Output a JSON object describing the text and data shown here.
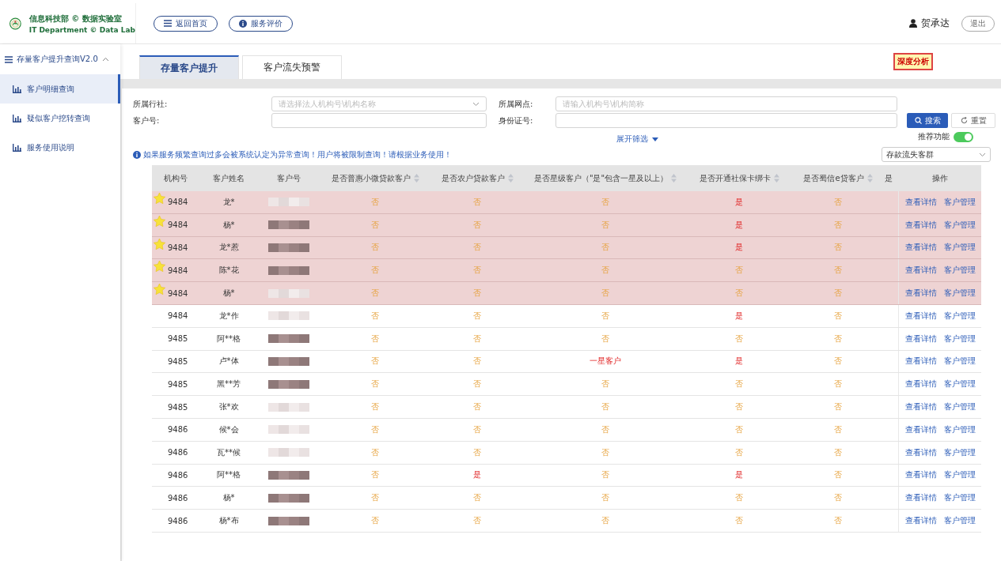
{
  "header": {
    "org_title": "信息科技部 © 数据实验室",
    "org_subtitle": "IT Department © Data Lab",
    "nav_buttons": [
      "返回首页",
      "服务评价"
    ],
    "user": "贺承达",
    "logout": "退出"
  },
  "sidebar": {
    "title": "存量客户提升查询V2.0",
    "expanded": true,
    "items": [
      {
        "label": "客户明细查询",
        "selected": true
      },
      {
        "label": "疑似客户挖转查询",
        "selected": false
      },
      {
        "label": "服务使用说明",
        "selected": false
      }
    ]
  },
  "tabs": [
    {
      "label": "存量客户提升",
      "selected": true
    },
    {
      "label": "客户流失预警",
      "selected": false
    }
  ],
  "badge": "深度分析",
  "form": {
    "fields": [
      {
        "label": "所属行社:",
        "placeholder": "请选择法人机构号\\机构名称",
        "kind": "select"
      },
      {
        "label": "所属网点:",
        "placeholder": "请输入机构号\\机构简称",
        "kind": "text"
      },
      {
        "label": "客户号:",
        "kind": "text"
      },
      {
        "label": "身份证号:",
        "kind": "text"
      }
    ],
    "search": "搜索",
    "reset": "重置",
    "expand": "展开筛选",
    "recommend": {
      "label": "推荐功能",
      "on": true
    },
    "group_select": "存款流失客群",
    "notice": "如果服务频繁查询过多会被系统认定为异常查询！用户将被限制查询！请根据业务使用！"
  },
  "table": {
    "columns": [
      {
        "label": "机构号",
        "sortable": false
      },
      {
        "label": "客户姓名",
        "sortable": false
      },
      {
        "label": "客户号",
        "sortable": false
      },
      {
        "label": "是否普惠小微贷款客户",
        "sortable": true
      },
      {
        "label": "是否农户贷款客户",
        "sortable": true
      },
      {
        "label": "是否星级客户（\"是\"包含一星及以上）",
        "sortable": true
      },
      {
        "label": "是否开通社保卡绑卡",
        "sortable": true
      },
      {
        "label": "是否蜀信e贷客户",
        "sortable": true
      },
      {
        "label": "是",
        "sortable": false
      },
      {
        "label": "操作",
        "sortable": false
      }
    ],
    "rows": [
      {
        "starred": true,
        "redacted": false,
        "cells": [
          "9484",
          "龙*",
          "",
          {
            "text": "否",
            "positive": false
          },
          {
            "text": "否",
            "positive": false
          },
          {
            "text": "否",
            "positive": false
          },
          {
            "text": "是",
            "positive": true
          },
          {
            "text": "否",
            "positive": false
          },
          ""
        ],
        "actions": [
          "查看详情",
          "客户管理"
        ]
      },
      {
        "starred": true,
        "redacted": true,
        "cells": [
          "9484",
          "杨*",
          "",
          {
            "text": "否",
            "positive": false
          },
          {
            "text": "否",
            "positive": false
          },
          {
            "text": "否",
            "positive": false
          },
          {
            "text": "是",
            "positive": true
          },
          {
            "text": "否",
            "positive": false
          },
          ""
        ],
        "actions": [
          "查看详情",
          "客户管理"
        ]
      },
      {
        "starred": true,
        "redacted": true,
        "cells": [
          "9484",
          "龙*惹",
          "",
          {
            "text": "否",
            "positive": false
          },
          {
            "text": "否",
            "positive": false
          },
          {
            "text": "否",
            "positive": false
          },
          {
            "text": "是",
            "positive": true
          },
          {
            "text": "否",
            "positive": false
          },
          ""
        ],
        "actions": [
          "查看详情",
          "客户管理"
        ]
      },
      {
        "starred": true,
        "redacted": true,
        "cells": [
          "9484",
          "陈*花",
          "",
          {
            "text": "否",
            "positive": false
          },
          {
            "text": "否",
            "positive": false
          },
          {
            "text": "否",
            "positive": false
          },
          {
            "text": "否",
            "positive": false
          },
          {
            "text": "否",
            "positive": false
          },
          ""
        ],
        "actions": [
          "查看详情",
          "客户管理"
        ]
      },
      {
        "starred": true,
        "redacted": false,
        "cells": [
          "9484",
          "杨*",
          "",
          {
            "text": "否",
            "positive": false
          },
          {
            "text": "否",
            "positive": false
          },
          {
            "text": "否",
            "positive": false
          },
          {
            "text": "否",
            "positive": false
          },
          {
            "text": "否",
            "positive": false
          },
          ""
        ],
        "actions": [
          "查看详情",
          "客户管理"
        ]
      },
      {
        "starred": false,
        "redacted": false,
        "cells": [
          "9484",
          "龙*作",
          "",
          {
            "text": "否",
            "positive": false
          },
          {
            "text": "否",
            "positive": false
          },
          {
            "text": "否",
            "positive": false
          },
          {
            "text": "是",
            "positive": true
          },
          {
            "text": "否",
            "positive": false
          },
          ""
        ],
        "actions": [
          "查看详情",
          "客户管理"
        ]
      },
      {
        "starred": false,
        "redacted": true,
        "cells": [
          "9485",
          "阿**格",
          "",
          {
            "text": "否",
            "positive": false
          },
          {
            "text": "否",
            "positive": false
          },
          {
            "text": "否",
            "positive": false
          },
          {
            "text": "否",
            "positive": false
          },
          {
            "text": "否",
            "positive": false
          },
          ""
        ],
        "actions": [
          "查看详情",
          "客户管理"
        ]
      },
      {
        "starred": false,
        "redacted": true,
        "cells": [
          "9485",
          "卢*体",
          "",
          {
            "text": "否",
            "positive": false
          },
          {
            "text": "否",
            "positive": false
          },
          {
            "text": "一星客户",
            "positive": true
          },
          {
            "text": "是",
            "positive": true
          },
          {
            "text": "否",
            "positive": false
          },
          ""
        ],
        "actions": [
          "查看详情",
          "客户管理"
        ]
      },
      {
        "starred": false,
        "redacted": true,
        "cells": [
          "9485",
          "黑**芳",
          "",
          {
            "text": "否",
            "positive": false
          },
          {
            "text": "否",
            "positive": false
          },
          {
            "text": "否",
            "positive": false
          },
          {
            "text": "否",
            "positive": false
          },
          {
            "text": "否",
            "positive": false
          },
          ""
        ],
        "actions": [
          "查看详情",
          "客户管理"
        ]
      },
      {
        "starred": false,
        "redacted": false,
        "cells": [
          "9485",
          "张*欢",
          "",
          {
            "text": "否",
            "positive": false
          },
          {
            "text": "否",
            "positive": false
          },
          {
            "text": "否",
            "positive": false
          },
          {
            "text": "否",
            "positive": false
          },
          {
            "text": "否",
            "positive": false
          },
          ""
        ],
        "actions": [
          "查看详情",
          "客户管理"
        ]
      },
      {
        "starred": false,
        "redacted": false,
        "cells": [
          "9486",
          "候*会",
          "",
          {
            "text": "否",
            "positive": false
          },
          {
            "text": "否",
            "positive": false
          },
          {
            "text": "否",
            "positive": false
          },
          {
            "text": "否",
            "positive": false
          },
          {
            "text": "否",
            "positive": false
          },
          ""
        ],
        "actions": [
          "查看详情",
          "客户管理"
        ]
      },
      {
        "starred": false,
        "redacted": false,
        "cells": [
          "9486",
          "瓦**候",
          "",
          {
            "text": "否",
            "positive": false
          },
          {
            "text": "否",
            "positive": false
          },
          {
            "text": "否",
            "positive": false
          },
          {
            "text": "否",
            "positive": false
          },
          {
            "text": "否",
            "positive": false
          },
          ""
        ],
        "actions": [
          "查看详情",
          "客户管理"
        ]
      },
      {
        "starred": false,
        "redacted": true,
        "cells": [
          "9486",
          "阿**格",
          "",
          {
            "text": "否",
            "positive": false
          },
          {
            "text": "是",
            "positive": true
          },
          {
            "text": "否",
            "positive": false
          },
          {
            "text": "是",
            "positive": true
          },
          {
            "text": "否",
            "positive": false
          },
          ""
        ],
        "actions": [
          "查看详情",
          "客户管理"
        ]
      },
      {
        "starred": false,
        "redacted": true,
        "cells": [
          "9486",
          "杨*",
          "",
          {
            "text": "否",
            "positive": false
          },
          {
            "text": "否",
            "positive": false
          },
          {
            "text": "否",
            "positive": false
          },
          {
            "text": "否",
            "positive": false
          },
          {
            "text": "否",
            "positive": false
          },
          ""
        ],
        "actions": [
          "查看详情",
          "客户管理"
        ]
      },
      {
        "starred": false,
        "redacted": true,
        "cells": [
          "9486",
          "杨*布",
          "",
          {
            "text": "否",
            "positive": false
          },
          {
            "text": "否",
            "positive": false
          },
          {
            "text": "否",
            "positive": false
          },
          {
            "text": "否",
            "positive": false
          },
          {
            "text": "否",
            "positive": false
          },
          ""
        ],
        "actions": [
          "查看详情",
          "客户管理"
        ]
      }
    ]
  }
}
